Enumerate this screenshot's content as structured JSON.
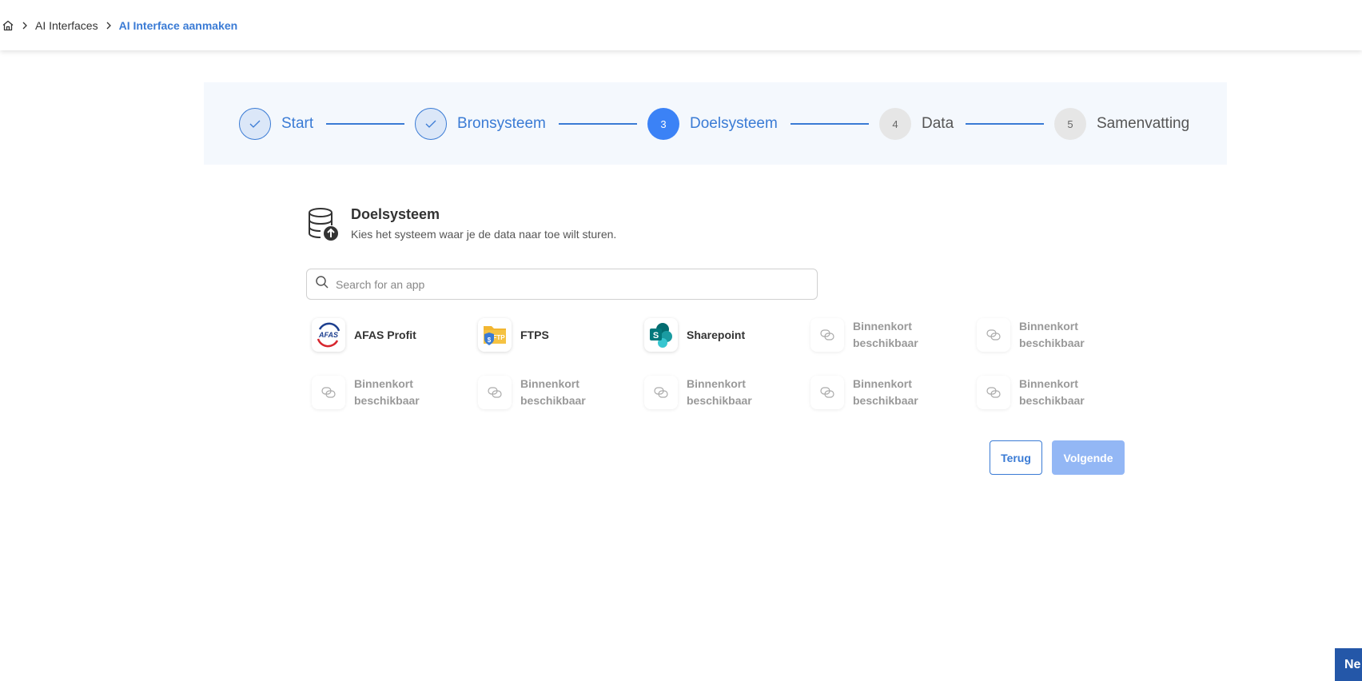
{
  "breadcrumb": {
    "items": [
      "AI Interfaces"
    ],
    "current": "AI Interface aanmaken"
  },
  "stepper": {
    "steps": [
      {
        "number": "",
        "label": "Start",
        "state": "done"
      },
      {
        "number": "",
        "label": "Bronsysteem",
        "state": "done"
      },
      {
        "number": "3",
        "label": "Doelsysteem",
        "state": "current"
      },
      {
        "number": "4",
        "label": "Data",
        "state": "todo"
      },
      {
        "number": "5",
        "label": "Samenvatting",
        "state": "todo"
      }
    ]
  },
  "section": {
    "title": "Doelsysteem",
    "subtitle": "Kies het systeem waar je de data naar toe wilt sturen."
  },
  "search": {
    "placeholder": "Search for an app",
    "value": ""
  },
  "apps": [
    {
      "name": "AFAS Profit",
      "icon": "afas-logo-icon",
      "available": true
    },
    {
      "name": "FTPS",
      "icon": "ftps-logo-icon",
      "available": true
    },
    {
      "name": "Sharepoint",
      "icon": "sharepoint-logo-icon",
      "available": true
    },
    {
      "name": "Binnenkort beschikbaar",
      "icon": "placeholder-app-icon",
      "available": false
    },
    {
      "name": "Binnenkort beschikbaar",
      "icon": "placeholder-app-icon",
      "available": false
    },
    {
      "name": "Binnenkort beschikbaar",
      "icon": "placeholder-app-icon",
      "available": false
    },
    {
      "name": "Binnenkort beschikbaar",
      "icon": "placeholder-app-icon",
      "available": false
    },
    {
      "name": "Binnenkort beschikbaar",
      "icon": "placeholder-app-icon",
      "available": false
    },
    {
      "name": "Binnenkort beschikbaar",
      "icon": "placeholder-app-icon",
      "available": false
    },
    {
      "name": "Binnenkort beschikbaar",
      "icon": "placeholder-app-icon",
      "available": false
    }
  ],
  "buttons": {
    "back": "Terug",
    "next": "Volgende"
  },
  "corner_button": {
    "label": "Ne"
  },
  "colors": {
    "accent": "#3a7bd5",
    "current_step": "#3b82f6",
    "next_disabled": "#93b7f5"
  }
}
